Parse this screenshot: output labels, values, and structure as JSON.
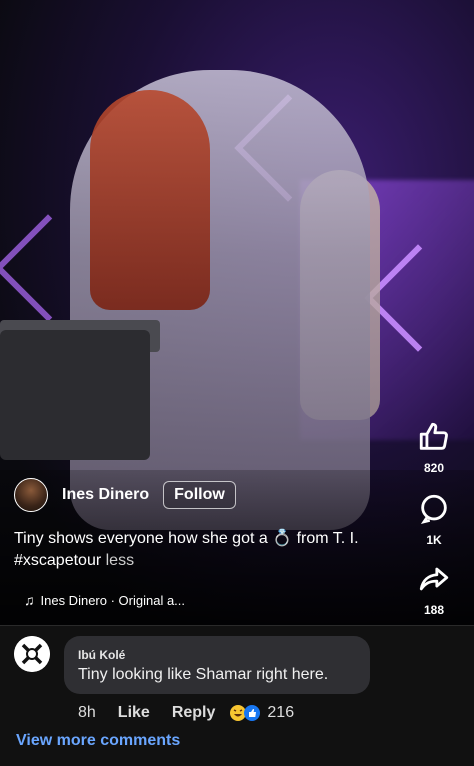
{
  "post": {
    "author": "Ines Dinero",
    "follow_label": "Follow",
    "caption_part1": "Tiny shows everyone how she got a ",
    "caption_part2": " from T. I. #xscapetour ",
    "caption_less": "less",
    "audio_label": "Ines Dinero · Original a..."
  },
  "actions": {
    "likes": "820",
    "comments": "1K",
    "shares": "188"
  },
  "comment": {
    "author": "Ibú Kolé",
    "text": "Tiny looking like Shamar right here.",
    "time": "8h",
    "like_label": "Like",
    "reply_label": "Reply",
    "reaction_count": "216"
  },
  "view_more": "View more comments",
  "icons": {
    "like": "thumbs-up-icon",
    "comment": "comment-bubble-icon",
    "share": "share-arrow-icon",
    "music": "music-note-icon",
    "ring": "ring-emoji"
  }
}
